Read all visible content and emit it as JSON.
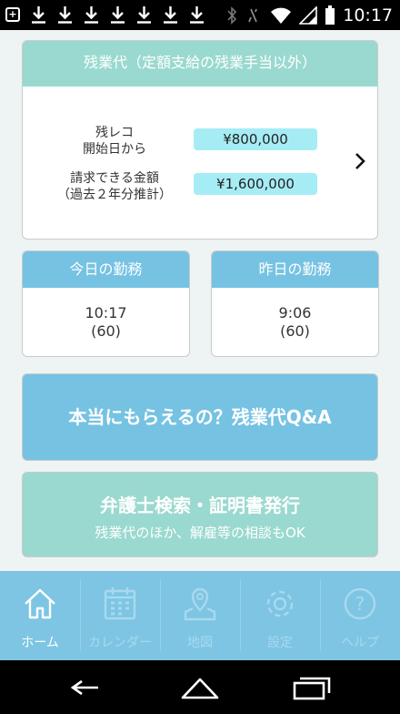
{
  "status_bar": {
    "time": "10:17",
    "icons": [
      "add-box-icon",
      "download-icon",
      "download-icon",
      "download-icon",
      "download-icon",
      "download-icon",
      "download-icon",
      "download-icon",
      "bluetooth-icon",
      "mute-icon",
      "wifi-icon",
      "signal-icon",
      "battery-icon"
    ]
  },
  "overtime": {
    "title": "残業代（定額支給の残業手当以外）",
    "since_label_line1": "残レコ",
    "since_label_line2": "開始日から",
    "since_value": "¥800,000",
    "claimable_label_line1": "請求できる金額",
    "claimable_label_line2": "（過去２年分推計）",
    "claimable_value": "¥1,600,000"
  },
  "today": {
    "title": "今日の勤務",
    "time": "10:17",
    "break": "(60)"
  },
  "yesterday": {
    "title": "昨日の勤務",
    "time": "9:06",
    "break": "(60)"
  },
  "qa_button": {
    "label": "本当にもらえるの？残業代Q&A"
  },
  "lawyer_button": {
    "title": "弁護士検索・証明書発行",
    "subtitle": "残業代のほか、解雇等の相談もOK"
  },
  "tabs": [
    {
      "label": "ホーム",
      "icon": "home-icon",
      "active": true
    },
    {
      "label": "カレンダー",
      "icon": "calendar-icon",
      "active": false
    },
    {
      "label": "地図",
      "icon": "map-icon",
      "active": false
    },
    {
      "label": "設定",
      "icon": "gear-icon",
      "active": false
    },
    {
      "label": "ヘルプ",
      "icon": "help-icon",
      "active": false
    }
  ],
  "nav": [
    "back-icon",
    "home-nav-icon",
    "recents-icon"
  ],
  "colors": {
    "mint": "#9ad9cf",
    "blue": "#76c2e2",
    "value_bg": "#a6ecf4",
    "tabbar": "#7dc5e3"
  }
}
